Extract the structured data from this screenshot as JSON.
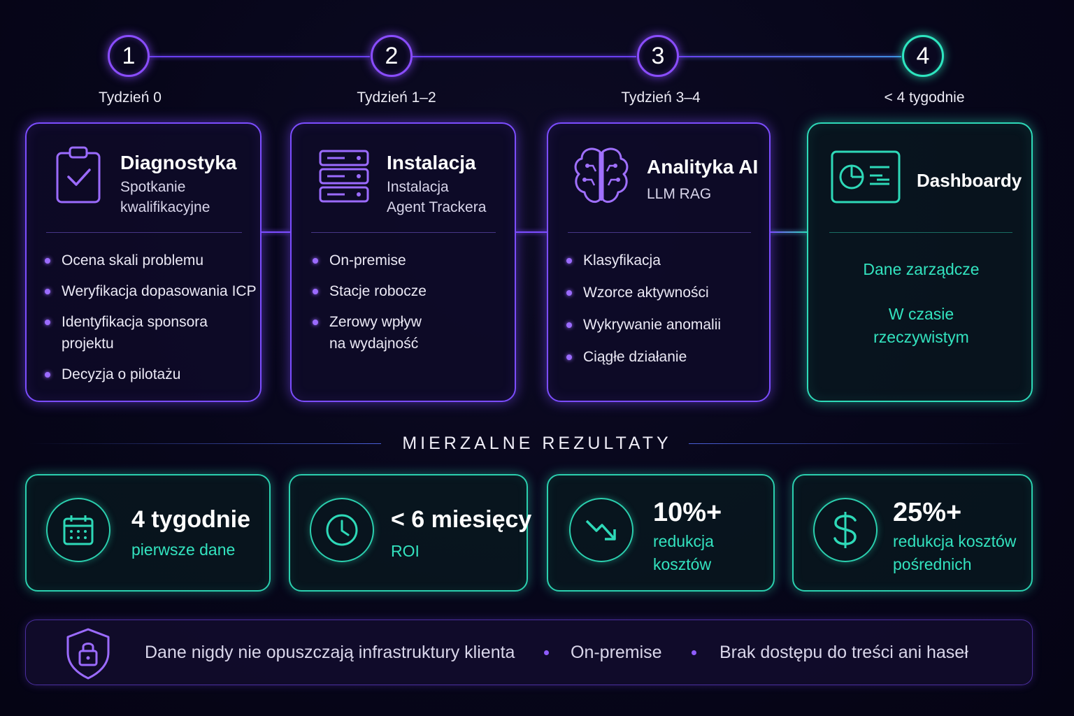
{
  "timeline": {
    "steps": [
      {
        "number": "1",
        "week": "Tydzień 0"
      },
      {
        "number": "2",
        "week": "Tydzień 1–2"
      },
      {
        "number": "3",
        "week": "Tydzień 3–4"
      },
      {
        "number": "4",
        "week": "< 4 tygodnie"
      }
    ]
  },
  "cards": [
    {
      "title": "Diagnostyka",
      "subtitle": "Spotkanie\nkwalifikacyjne",
      "icon": "clipboard-check-icon",
      "bullets": [
        "Ocena skali problemu",
        "Weryfikacja dopasowania ICP",
        "Identyfikacja sponsora\nprojektu",
        "Decyzja o pilotażu"
      ]
    },
    {
      "title": "Instalacja",
      "subtitle": "Instalacja\nAgent Trackera",
      "icon": "server-icon",
      "bullets": [
        "On-premise",
        "Stacje robocze",
        "Zerowy wpływ\nna wydajność"
      ]
    },
    {
      "title": "Analityka AI",
      "subtitle": "LLM RAG",
      "icon": "brain-icon",
      "bullets": [
        "Klasyfikacja",
        "Wzorce aktywności",
        "Wykrywanie anomalii",
        "Ciągłe działanie"
      ]
    },
    {
      "title": "Dashboardy",
      "icon": "dashboard-icon",
      "lines": [
        "Dane zarządcze",
        "W czasie\nrzeczywistym"
      ]
    }
  ],
  "results": {
    "title": "MIERZALNE REZULTATY",
    "items": [
      {
        "value": "4 tygodnie",
        "desc": "pierwsze dane",
        "icon": "calendar-icon"
      },
      {
        "value": "< 6 miesięcy",
        "desc": "ROI",
        "icon": "clock-icon"
      },
      {
        "value": "10%+",
        "desc": "redukcja\nkosztów",
        "icon": "trend-down-icon"
      },
      {
        "value": "25%+",
        "desc": "redukcja kosztów\npośrednich",
        "icon": "dollar-icon"
      }
    ]
  },
  "footer": {
    "icon": "shield-lock-icon",
    "items": [
      "Dane nigdy nie opuszczają infrastruktury klienta",
      "On-premise",
      "Brak dostępu do treści ani haseł"
    ]
  },
  "colors": {
    "purple": "#7c4dff",
    "teal": "#2ed9b8",
    "background": "#07061a"
  }
}
